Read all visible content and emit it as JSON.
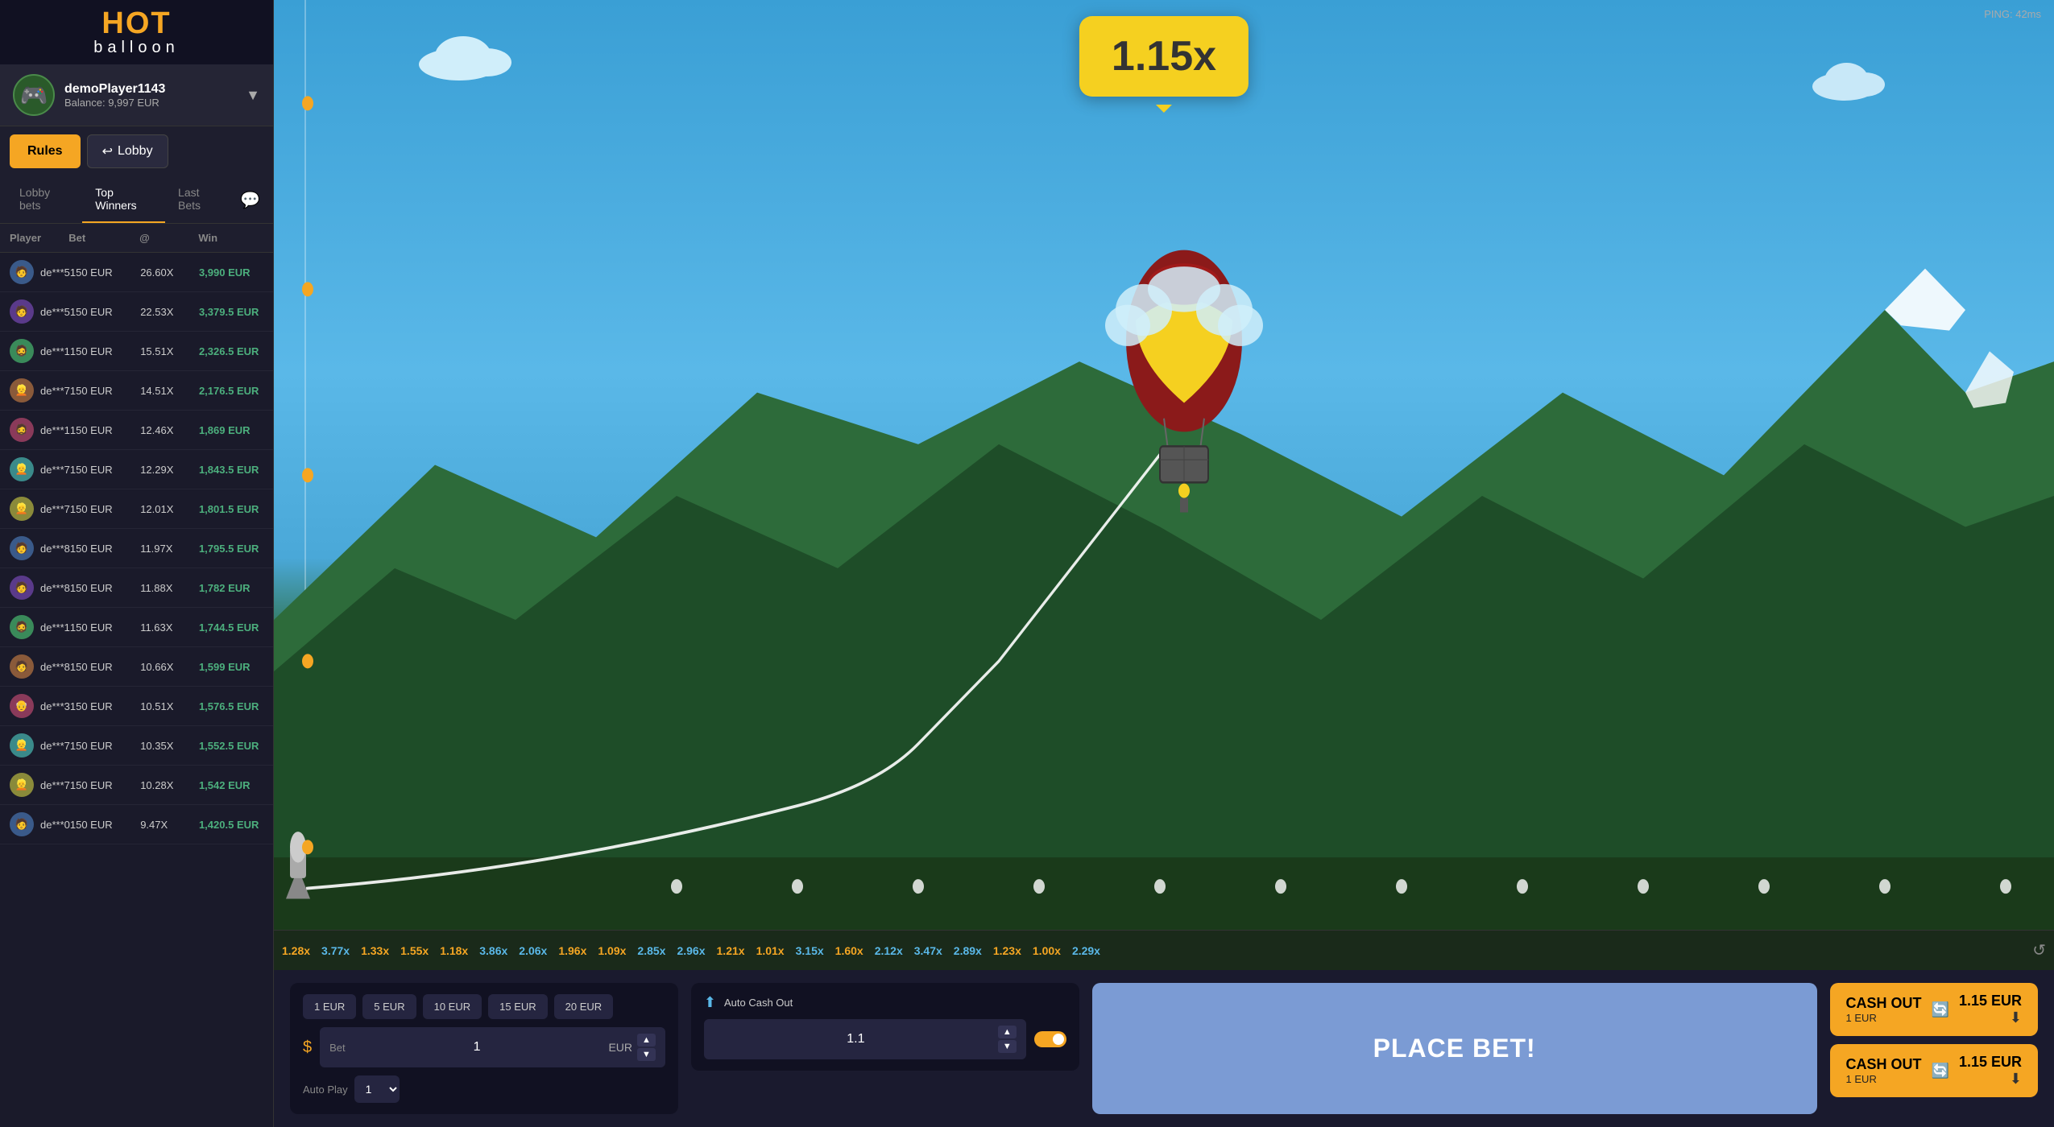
{
  "app": {
    "title": "HOT balloon",
    "ping": "PING: 42ms"
  },
  "sidebar": {
    "logo": {
      "main": "HOT",
      "sub": "balloon"
    },
    "user": {
      "name": "demoPlayer1143",
      "balance": "Balance: 9,997 EUR",
      "avatar_emoji": "🎮"
    },
    "buttons": {
      "rules": "Rules",
      "lobby_arrow": "↩",
      "lobby": "Lobby"
    },
    "tabs": [
      {
        "id": "lobby-bets",
        "label": "Lobby bets"
      },
      {
        "id": "top-winners",
        "label": "Top Winners"
      },
      {
        "id": "last-bets",
        "label": "Last Bets"
      }
    ],
    "active_tab": "top-winners",
    "table": {
      "headers": [
        "Player",
        "Bet",
        "@",
        "Win"
      ],
      "rows": [
        {
          "player": "de***5",
          "bet": "150 EUR",
          "mult": "26.60X",
          "win": "3,990 EUR",
          "avatar": "🧑"
        },
        {
          "player": "de***5",
          "bet": "150 EUR",
          "mult": "22.53X",
          "win": "3,379.5 EUR",
          "avatar": "🧑"
        },
        {
          "player": "de***1",
          "bet": "150 EUR",
          "mult": "15.51X",
          "win": "2,326.5 EUR",
          "avatar": "🧔"
        },
        {
          "player": "de***7",
          "bet": "150 EUR",
          "mult": "14.51X",
          "win": "2,176.5 EUR",
          "avatar": "👱"
        },
        {
          "player": "de***1",
          "bet": "150 EUR",
          "mult": "12.46X",
          "win": "1,869 EUR",
          "avatar": "🧔"
        },
        {
          "player": "de***7",
          "bet": "150 EUR",
          "mult": "12.29X",
          "win": "1,843.5 EUR",
          "avatar": "👱"
        },
        {
          "player": "de***7",
          "bet": "150 EUR",
          "mult": "12.01X",
          "win": "1,801.5 EUR",
          "avatar": "👱"
        },
        {
          "player": "de***8",
          "bet": "150 EUR",
          "mult": "11.97X",
          "win": "1,795.5 EUR",
          "avatar": "🧑"
        },
        {
          "player": "de***8",
          "bet": "150 EUR",
          "mult": "11.88X",
          "win": "1,782 EUR",
          "avatar": "🧑"
        },
        {
          "player": "de***1",
          "bet": "150 EUR",
          "mult": "11.63X",
          "win": "1,744.5 EUR",
          "avatar": "🧔"
        },
        {
          "player": "de***8",
          "bet": "150 EUR",
          "mult": "10.66X",
          "win": "1,599 EUR",
          "avatar": "🧑"
        },
        {
          "player": "de***3",
          "bet": "150 EUR",
          "mult": "10.51X",
          "win": "1,576.5 EUR",
          "avatar": "👴"
        },
        {
          "player": "de***7",
          "bet": "150 EUR",
          "mult": "10.35X",
          "win": "1,552.5 EUR",
          "avatar": "👱"
        },
        {
          "player": "de***7",
          "bet": "150 EUR",
          "mult": "10.28X",
          "win": "1,542 EUR",
          "avatar": "👱"
        },
        {
          "player": "de***0",
          "bet": "150 EUR",
          "mult": "9.47X",
          "win": "1,420.5 EUR",
          "avatar": "🧑"
        }
      ]
    }
  },
  "game": {
    "current_multiplier": "1.15x",
    "history": [
      "1.28x",
      "3.77x",
      "1.33x",
      "1.55x",
      "1.18x",
      "3.86x",
      "2.06x",
      "1.96x",
      "1.09x",
      "2.85x",
      "2.96x",
      "1.21x",
      "1.01x",
      "3.15x",
      "1.60x",
      "2.12x",
      "3.47x",
      "2.89x",
      "1.23x",
      "1.00x",
      "2.29x"
    ]
  },
  "controls": {
    "quick_amounts": [
      "1 EUR",
      "5 EUR",
      "10 EUR",
      "15 EUR",
      "20 EUR"
    ],
    "bet_label": "Bet",
    "bet_value": "1",
    "bet_currency": "EUR",
    "auto_cash_out_label": "Auto Cash Out",
    "auto_cash_out_value": "1.1",
    "auto_play_label": "Auto Play",
    "auto_play_value": "1",
    "place_bet_label": "PLACE BET!",
    "cash_out_label": "CASH OUT",
    "cash_out_amount_1": "1 EUR",
    "cash_out_value_1": "1.15 EUR",
    "cash_out_amount_2": "1 EUR",
    "cash_out_value_2": "1.15 EUR"
  }
}
